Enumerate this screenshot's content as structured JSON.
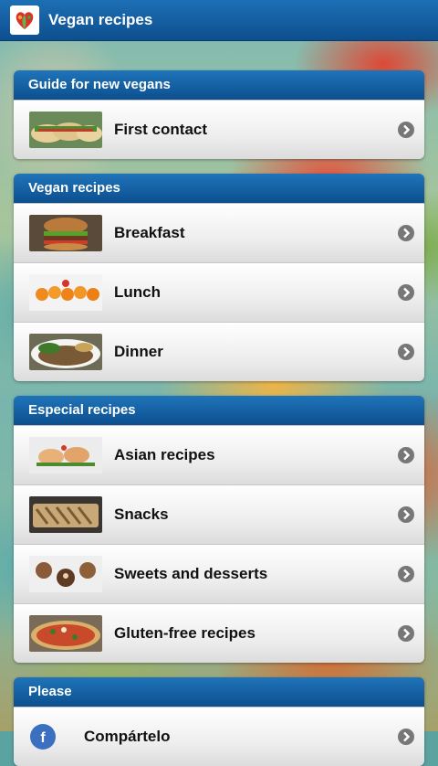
{
  "app": {
    "title": "Vegan recipes"
  },
  "sections": [
    {
      "header": "Guide for new vegans",
      "items": [
        {
          "label": "First contact",
          "thumb": "tacos-image"
        }
      ]
    },
    {
      "header": "Vegan recipes",
      "items": [
        {
          "label": "Breakfast",
          "thumb": "burger-image"
        },
        {
          "label": "Lunch",
          "thumb": "croquettes-image"
        },
        {
          "label": "Dinner",
          "thumb": "lentil-plate-image"
        }
      ]
    },
    {
      "header": "Especial recipes",
      "items": [
        {
          "label": "Asian recipes",
          "thumb": "dumplings-image"
        },
        {
          "label": "Snacks",
          "thumb": "snack-tray-image"
        },
        {
          "label": "Sweets and desserts",
          "thumb": "cookies-image"
        },
        {
          "label": "Gluten-free recipes",
          "thumb": "pizza-image"
        }
      ]
    },
    {
      "header": "Please",
      "items": [
        {
          "label": "Compártelo",
          "thumb": "facebook-icon"
        }
      ]
    }
  ],
  "colors": {
    "header_blue": "#0d4f8e",
    "chevron_gray": "#777777"
  }
}
